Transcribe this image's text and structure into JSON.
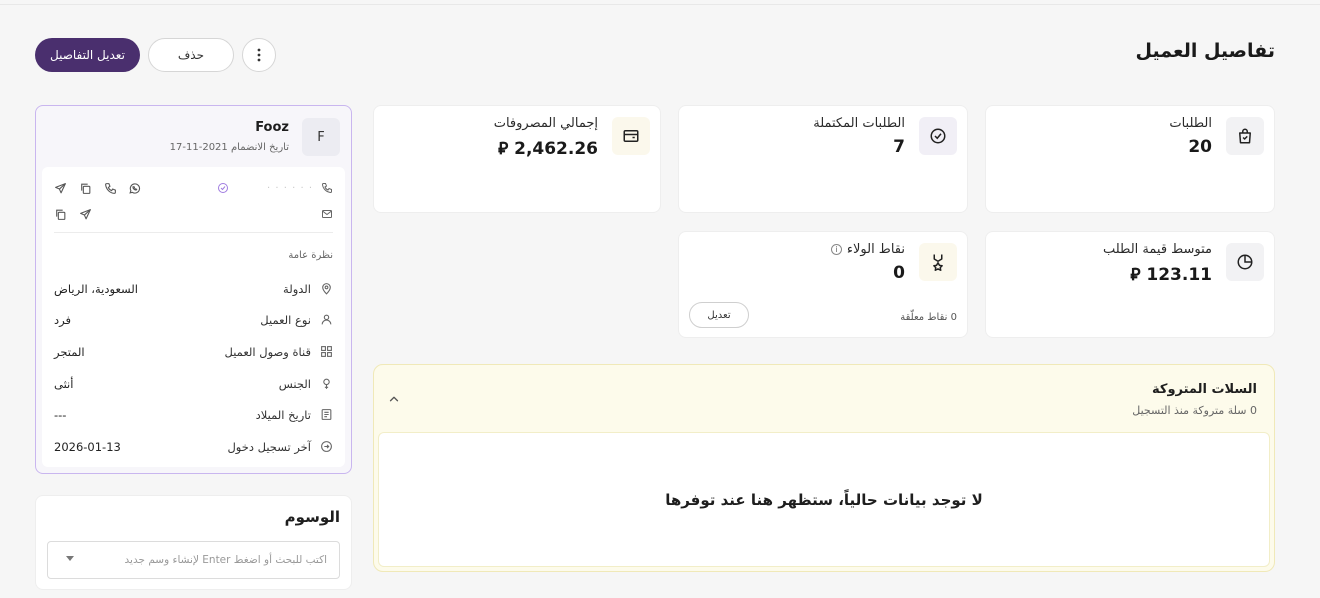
{
  "header": {
    "title": "تفاصيل العميل",
    "edit_label": "تعديل التفاصيل",
    "delete_label": "حذف"
  },
  "stats": {
    "orders": {
      "label": "الطلبات",
      "value": "20"
    },
    "completed": {
      "label": "الطلبات المكتملة",
      "value": "7"
    },
    "spending": {
      "label": "إجمالي المصروفات",
      "value": "2,462.26 ⃁"
    },
    "avg_order": {
      "label": "متوسط قيمة الطلب",
      "value": "123.11 ⃁"
    },
    "loyalty": {
      "label": "نقاط الولاء",
      "value": "0",
      "pending": "0 نقاط معلّقة",
      "edit_label": "تعديل"
    }
  },
  "carts": {
    "title": "السلات المتروكة",
    "subtitle": "0 سلة متروكة منذ التسجيل",
    "empty": "لا توجد بيانات حالياً، ستظهر هنا عند توفرها"
  },
  "customer": {
    "initial": "F",
    "name": "Fooz",
    "join_date": "تاريخ الانضمام 2021-11-17",
    "phone_masked": "· · · · · ·",
    "overview_label": "نظرة عامة",
    "fields": [
      {
        "key": "الدولة",
        "value": "السعودية، الرياض"
      },
      {
        "key": "نوع العميل",
        "value": "فرد"
      },
      {
        "key": "قناة وصول العميل",
        "value": "المتجر"
      },
      {
        "key": "الجنس",
        "value": "أنثى"
      },
      {
        "key": "تاريخ الميلاد",
        "value": "---"
      },
      {
        "key": "آخر تسجيل دخول",
        "value": "2026-01-13"
      }
    ]
  },
  "tags": {
    "title": "الوسوم",
    "placeholder": "اكتب للبحث أو اضغط Enter لإنشاء وسم جديد"
  },
  "colors": {
    "primary": "#4a2f6e",
    "accent_border": "#c9b6ef",
    "verified": "#a07ce0",
    "carts_bg": "#fdfbeb"
  }
}
